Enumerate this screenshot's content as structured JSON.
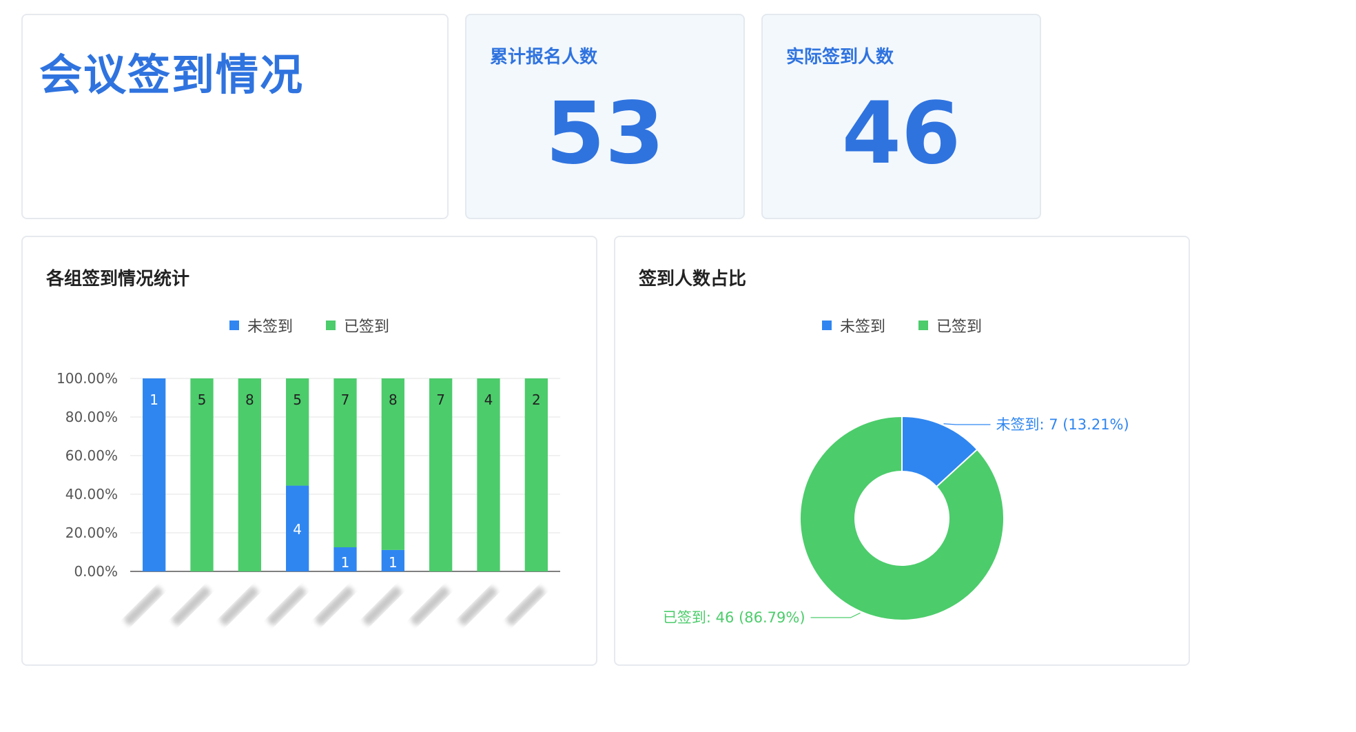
{
  "page": {
    "title": "会议签到情况"
  },
  "stats": {
    "registered": {
      "label": "累计报名人数",
      "value": "53"
    },
    "checked_in": {
      "label": "实际签到人数",
      "value": "46"
    }
  },
  "colors": {
    "accent": "#2f73df",
    "unsigned": "#2f86f0",
    "signed": "#4ccc6b"
  },
  "chart_data": [
    {
      "type": "bar",
      "stacked": true,
      "percent": true,
      "title": "各组签到情况统计",
      "categories": [
        "",
        "",
        "",
        "",
        "",
        "",
        "",
        "",
        ""
      ],
      "categories_note": "x tick labels are blurred in the original",
      "series": [
        {
          "name": "未签到",
          "color": "#2f86f0",
          "values": [
            1,
            0,
            0,
            4,
            1,
            1,
            0,
            0,
            0
          ]
        },
        {
          "name": "已签到",
          "color": "#4ccc6b",
          "values": [
            0,
            5,
            8,
            5,
            7,
            8,
            7,
            4,
            2
          ]
        }
      ],
      "yticks": [
        "0.00%",
        "20.00%",
        "40.00%",
        "60.00%",
        "80.00%",
        "100.00%"
      ],
      "ylim": [
        0,
        100
      ],
      "legend": "top-center",
      "grid": true
    },
    {
      "type": "pie",
      "donut": true,
      "title": "签到人数占比",
      "slices": [
        {
          "name": "未签到",
          "value": 7,
          "percent": 13.21,
          "label": "未签到: 7 (13.21%)",
          "color": "#2f86f0"
        },
        {
          "name": "已签到",
          "value": 46,
          "percent": 86.79,
          "label": "已签到: 46 (86.79%)",
          "color": "#4ccc6b"
        }
      ],
      "legend": "top-center"
    }
  ]
}
